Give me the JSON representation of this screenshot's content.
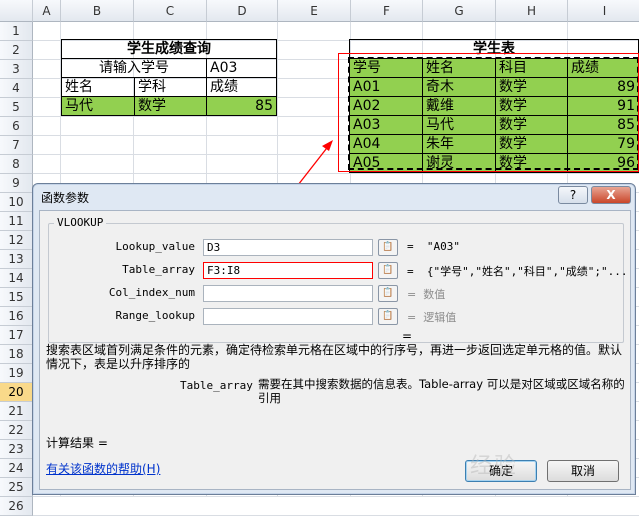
{
  "spreadsheet": {
    "columns": [
      "A",
      "B",
      "C",
      "D",
      "E",
      "F",
      "G",
      "H",
      "I"
    ],
    "rows": [
      "1",
      "2",
      "3",
      "4",
      "5",
      "6",
      "7",
      "8",
      "9",
      "10",
      "11",
      "12",
      "13",
      "14",
      "15",
      "16",
      "17",
      "18",
      "19",
      "20",
      "21",
      "22",
      "23",
      "24",
      "25",
      "26"
    ],
    "selected_row": "20",
    "query_table": {
      "title": "学生成绩查询",
      "prompt": "请输入学号",
      "input_value": "A03",
      "headers": [
        "姓名",
        "学科",
        "成绩"
      ],
      "result": [
        "马代",
        "数学",
        "85"
      ]
    },
    "student_table": {
      "title": "学生表",
      "headers": [
        "学号",
        "姓名",
        "科目",
        "成绩"
      ],
      "rows": [
        [
          "A01",
          "奇木",
          "数学",
          "89"
        ],
        [
          "A02",
          "戴维",
          "数学",
          "91"
        ],
        [
          "A03",
          "马代",
          "数学",
          "85"
        ],
        [
          "A04",
          "朱年",
          "数学",
          "79"
        ],
        [
          "A05",
          "谢灵",
          "数学",
          "96"
        ]
      ]
    }
  },
  "dialog": {
    "title": "函数参数",
    "help_btn": "?",
    "close_btn": "X",
    "function_name": "VLOOKUP",
    "args": [
      {
        "label": "Lookup_value",
        "value": "D3",
        "result": "\"A03\""
      },
      {
        "label": "Table_array",
        "value": "F3:I8",
        "result": "{\"学号\",\"姓名\",\"科目\",\"成绩\";\"..."
      },
      {
        "label": "Col_index_num",
        "value": "",
        "result": "数值"
      },
      {
        "label": "Range_lookup",
        "value": "",
        "result": "逻辑值"
      }
    ],
    "ref_btn_label": "📋",
    "equals_sign": "=",
    "bare_equals": "=",
    "description": "搜索表区域首列满足条件的元素，确定待检索单元格在区域中的行序号，再进一步返回选定单元格的值。默认情况下，表是以升序排序的",
    "param_name": "Table_array",
    "param_desc": "需要在其中搜索数据的信息表。Table-array 可以是对区域或区域名称的引用",
    "calc_result": "计算结果 =",
    "help_link": "有关该函数的帮助(H)",
    "ok": "确定",
    "cancel": "取消"
  },
  "watermark": "经验",
  "colors": {
    "accent_green": "#92d050",
    "highlight_red": "#ff0000",
    "selected_row": "#f9d98a"
  }
}
